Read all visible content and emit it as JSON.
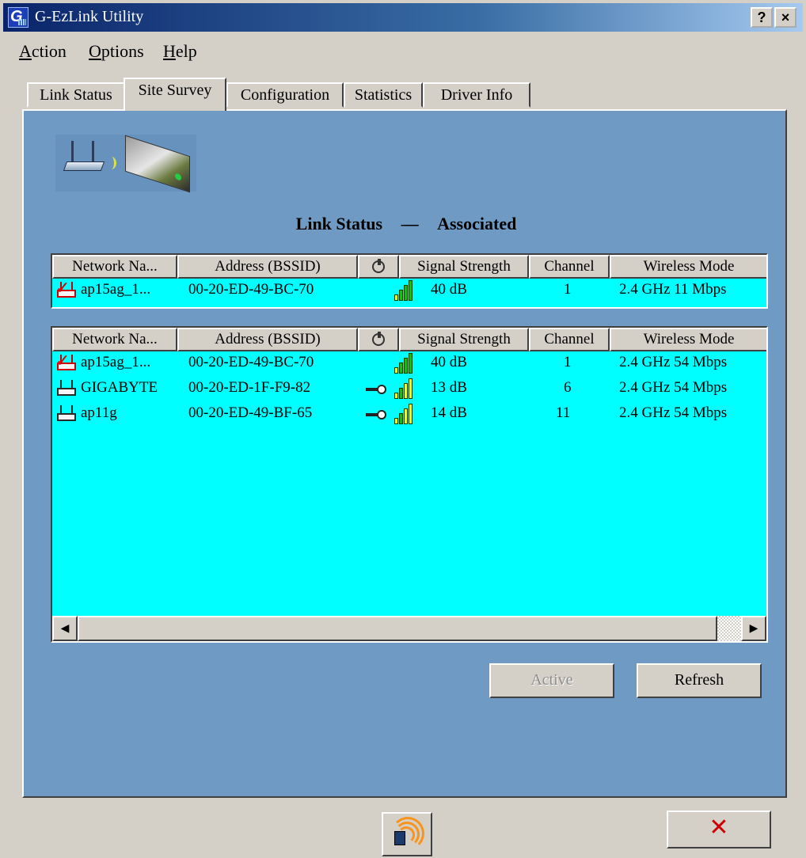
{
  "window": {
    "title": "G-EzLink Utility",
    "help_btn": "?",
    "close_btn": "×"
  },
  "menu": [
    {
      "first": "A",
      "rest": "ction"
    },
    {
      "first": "O",
      "rest": "ptions"
    },
    {
      "first": "H",
      "rest": "elp"
    }
  ],
  "tabs": [
    {
      "label": "Link Status"
    },
    {
      "label": "Site Survey",
      "active": true
    },
    {
      "label": "Configuration"
    },
    {
      "label": "Statistics"
    },
    {
      "label": "Driver Info"
    }
  ],
  "status": {
    "label": "Link Status",
    "dash": "—",
    "value": "Associated"
  },
  "columns": [
    "Network Na...",
    "Address (BSSID)",
    "Signal Strength",
    "Channel",
    "Wireless Mode"
  ],
  "current": [
    {
      "name": "ap15ag_1...",
      "bssid": "00-20-ED-49-BC-70",
      "signal": "40 dB",
      "channel": "1",
      "mode": "2.4 GHz 11 Mbps",
      "encrypted": false,
      "connected": true
    }
  ],
  "survey": [
    {
      "name": "ap15ag_1...",
      "bssid": "00-20-ED-49-BC-70",
      "signal": "40 dB",
      "channel": "1",
      "mode": "2.4 GHz 54 Mbps",
      "encrypted": false,
      "connected": true
    },
    {
      "name": "GIGABYTE",
      "bssid": "00-20-ED-1F-F9-82",
      "signal": "13 dB",
      "channel": "6",
      "mode": "2.4 GHz 54 Mbps",
      "encrypted": true,
      "connected": false
    },
    {
      "name": "ap11g",
      "bssid": "00-20-ED-49-BF-65",
      "signal": "14 dB",
      "channel": "11",
      "mode": "2.4 GHz 54 Mbps",
      "encrypted": true,
      "connected": false
    }
  ],
  "buttons": {
    "active": "Active",
    "refresh": "Refresh"
  },
  "bottom": {
    "close_glyph": "✕"
  },
  "colors": {
    "panel": "#6e9ac3",
    "list_bg": "#00ffff",
    "title_start": "#0a246a"
  }
}
